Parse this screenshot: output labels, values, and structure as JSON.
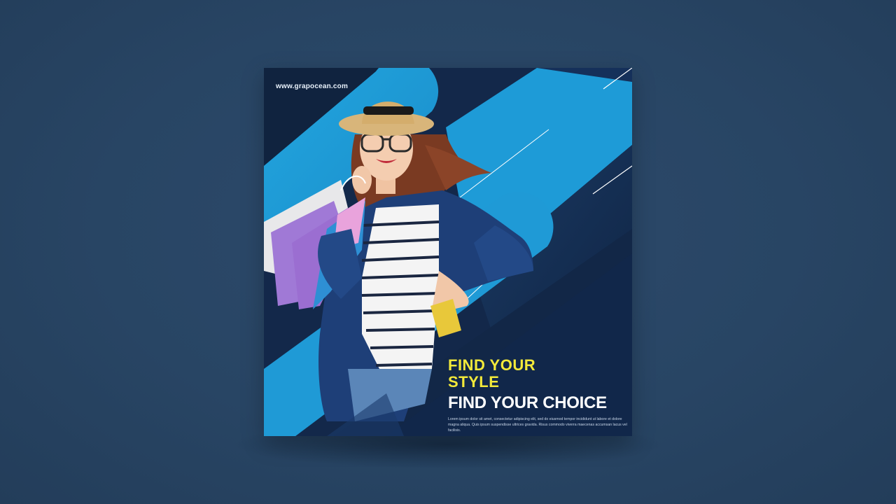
{
  "flyer": {
    "website": "www.grapocean.com",
    "headline_line1": "FIND YOUR",
    "headline_line2": "STYLE",
    "headline_secondary": "FIND YOUR CHOICE",
    "body_copy": "Lorem ipsum dolor sit amet, consectetur adipiscing elit, sed do eiusmod tempor incididunt ut labore et dolore magna aliqua. Quis ipsum suspendisse ultrices gravida. Risus commodo viverra maecenas accumsan lacus vel facilisis."
  },
  "colors": {
    "page_background": "#284564",
    "card_dark": "#132848",
    "accent_blue": "#1e9bd7",
    "headline_yellow": "#f2e93a",
    "text_white": "#ffffff"
  }
}
